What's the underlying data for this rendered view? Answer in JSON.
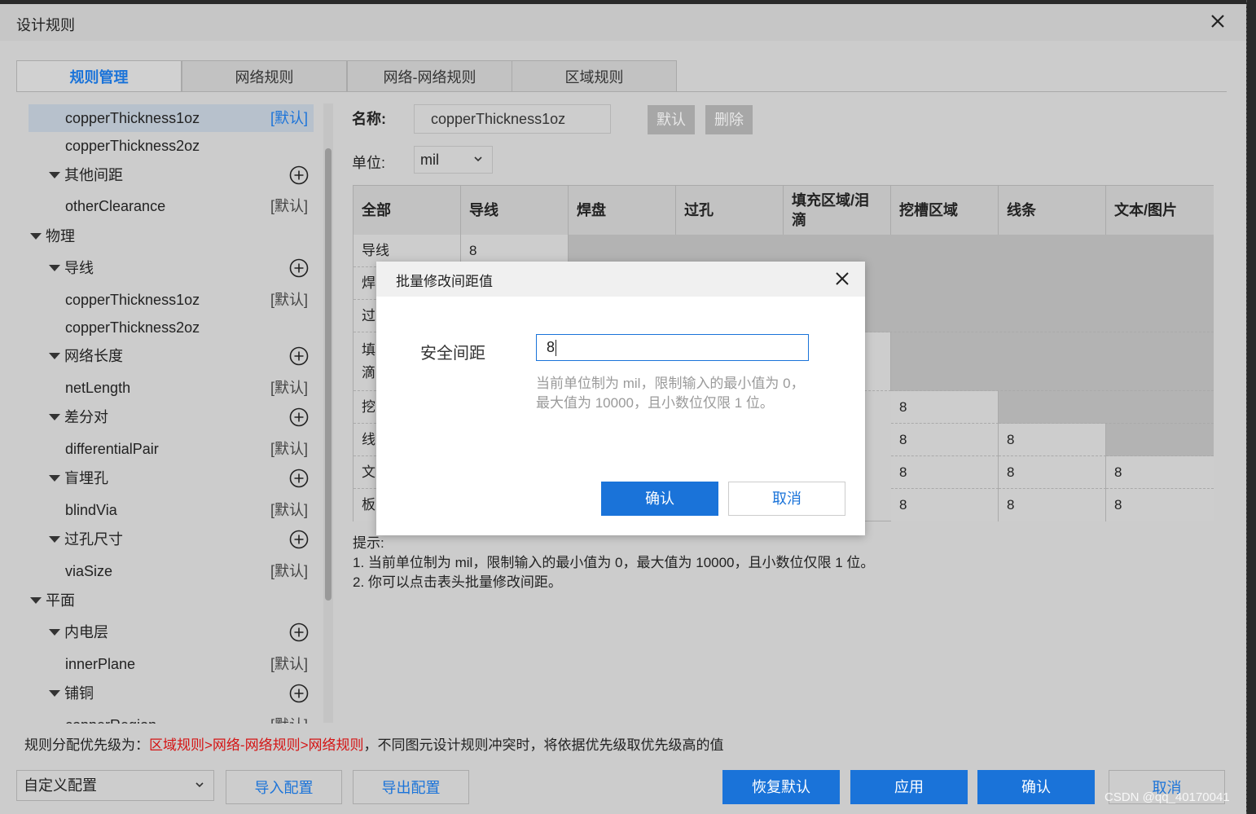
{
  "window": {
    "title": "设计规则"
  },
  "tabs": [
    {
      "label": "规则管理"
    },
    {
      "label": "网络规则"
    },
    {
      "label": "网络-网络规则"
    },
    {
      "label": "区域规则"
    }
  ],
  "tree": {
    "default_tag": "[默认]",
    "items": [
      {
        "label": "copperThickness1oz"
      },
      {
        "label": "copperThickness2oz"
      },
      {
        "label": "其他间距"
      },
      {
        "label": "otherClearance"
      },
      {
        "label": "物理"
      },
      {
        "label": "导线"
      },
      {
        "label": "copperThickness1oz"
      },
      {
        "label": "copperThickness2oz"
      },
      {
        "label": "网络长度"
      },
      {
        "label": "netLength"
      },
      {
        "label": "差分对"
      },
      {
        "label": "differentialPair"
      },
      {
        "label": "盲埋孔"
      },
      {
        "label": "blindVia"
      },
      {
        "label": "过孔尺寸"
      },
      {
        "label": "viaSize"
      },
      {
        "label": "平面"
      },
      {
        "label": "内电层"
      },
      {
        "label": "innerPlane"
      },
      {
        "label": "铺铜"
      },
      {
        "label": "copperRegion"
      }
    ]
  },
  "form": {
    "name_label": "名称:",
    "name_value": "copperThickness1oz",
    "default_button": "默认",
    "delete_button": "删除",
    "unit_label": "单位:",
    "unit_value": "mil"
  },
  "grid": {
    "headers": [
      "全部",
      "导线",
      "焊盘",
      "过孔",
      "填充区域/泪滴",
      "挖槽区域",
      "线条",
      "文本/图片"
    ],
    "row_labels": [
      "导线",
      "焊",
      "过",
      "填\n滴",
      "挖",
      "线",
      "文",
      "板"
    ],
    "values": {
      "r0c1": "8",
      "r4c5": "8",
      "r5c5": "8",
      "r5c6": "8",
      "r6c5": "8",
      "r6c6": "8",
      "r6c7": "8",
      "r7c5": "8",
      "r7c6": "8",
      "r7c7": "8"
    }
  },
  "hints": {
    "title": "提示:",
    "line1": "1. 当前单位制为 mil，限制输入的最小值为 0，最大值为 10000，且小数位仅限 1 位。",
    "line2": "2. 你可以点击表头批量修改间距。"
  },
  "priority": {
    "prefix": "规则分配优先级为：",
    "order": "区域规则>网络-网络规则>网络规则",
    "suffix": "，不同图元设计规则冲突时，将依据优先级取优先级高的值"
  },
  "footer": {
    "config_select": "自定义配置",
    "import_button": "导入配置",
    "export_button": "导出配置",
    "restore_button": "恢复默认",
    "apply_button": "应用",
    "confirm_button": "确认",
    "cancel_button": "取消"
  },
  "dialog": {
    "title": "批量修改间距值",
    "field_label": "安全间距",
    "field_value": "8",
    "help": "当前单位制为 mil，限制输入的最小值为 0，最大值为 10000，且小数位仅限 1 位。",
    "ok_button": "确认",
    "cancel_button": "取消"
  },
  "watermark": "CSDN @qq_40170041",
  "colors": {
    "accent": "#1a73d9",
    "priority_red": "#d41414"
  }
}
